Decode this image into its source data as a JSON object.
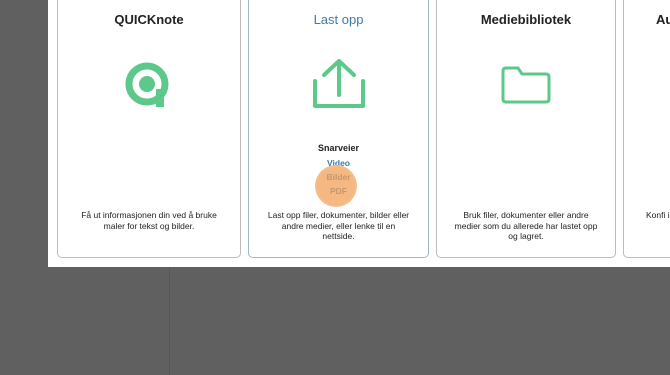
{
  "cards": [
    {
      "title": "QUICKnote",
      "icon": "quicknote-logo-icon",
      "description": "Få ut informasjonen din ved å bruke maler for tekst og bilder."
    },
    {
      "title": "Last opp",
      "icon": "upload-icon",
      "shortcuts_title": "Snarveier",
      "shortcuts": [
        "Video",
        "Bilder",
        "PDF"
      ],
      "description": "Last opp filer, dokumenter, bilder eller andre medier, eller lenke til en nettside."
    },
    {
      "title": "Mediebibliotek",
      "icon": "folder-icon",
      "description": "Bruk filer, dokumenter eller andre medier som du allerede har lastet opp og lagret."
    },
    {
      "title": "Au",
      "description": "Konfi innho"
    }
  ],
  "colors": {
    "accent_green": "#5cc98a",
    "link_blue": "#3d7ba8",
    "highlight_orange": "#f2a05a",
    "backdrop": "#606060"
  }
}
